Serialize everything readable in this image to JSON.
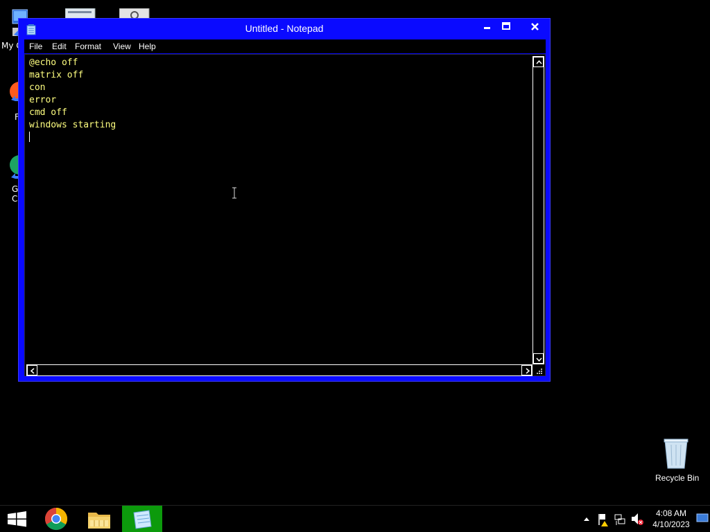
{
  "desktop": {
    "icons_left": [
      {
        "label": "My C",
        "icon": "computer-icon"
      },
      {
        "label": "F",
        "icon": "firefox-icon"
      },
      {
        "label": "G\nC",
        "icon": "chrome-icon"
      }
    ],
    "recycle_bin": {
      "label": "Recycle Bin",
      "icon": "recycle-bin-icon"
    }
  },
  "window": {
    "title": "Untitled - Notepad",
    "controls": {
      "minimize": "minimize-icon",
      "maximize": "maximize-icon",
      "close": "close-icon"
    },
    "menu": [
      "File",
      "Edit",
      "Format",
      "View",
      "Help"
    ],
    "content": "@echo off\nmatrix off\ncon\nerror\ncmd off\nwindows starting\n"
  },
  "taskbar": {
    "apps": [
      "start-icon",
      "chrome-icon",
      "file-explorer-icon",
      "notepad-icon"
    ],
    "active_app": "notepad",
    "tray_icons": [
      "show-hidden-icons",
      "action-center-flag-icon",
      "network-icon",
      "volume-muted-icon"
    ],
    "time": "4:08 AM",
    "date": "4/10/2023"
  },
  "colors": {
    "window_frame": "#0a0aff",
    "text": "#ffff80",
    "background": "#000000",
    "active_taskbar": "#0c9a0c"
  }
}
